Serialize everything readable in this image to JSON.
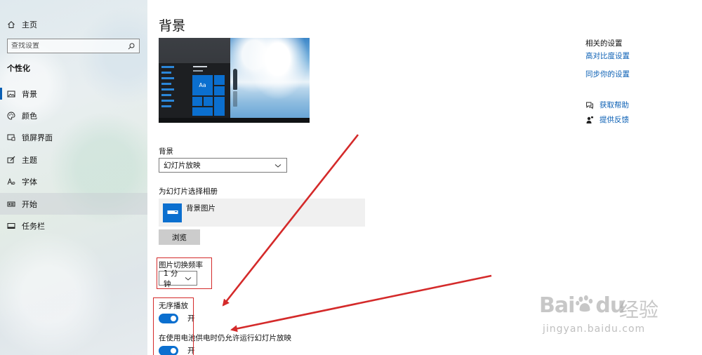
{
  "sidebar": {
    "home_label": "主页",
    "search_placeholder": "查找设置",
    "section_title": "个性化",
    "items": [
      {
        "label": "背景",
        "icon": "image-icon"
      },
      {
        "label": "颜色",
        "icon": "palette-icon"
      },
      {
        "label": "锁屏界面",
        "icon": "lock-screen-icon"
      },
      {
        "label": "主题",
        "icon": "theme-icon"
      },
      {
        "label": "字体",
        "icon": "font-icon"
      },
      {
        "label": "开始",
        "icon": "start-icon"
      },
      {
        "label": "任务栏",
        "icon": "taskbar-icon"
      }
    ]
  },
  "main": {
    "title": "背景",
    "preview_tile_text": "Aa",
    "background_label": "背景",
    "background_value": "幻灯片放映",
    "album_label": "为幻灯片选择相册",
    "album_name": "背景图片",
    "browse_label": "浏览",
    "frequency_label": "图片切换频率",
    "frequency_value": "1 分钟",
    "shuffle_label": "无序播放",
    "shuffle_state": "开",
    "battery_label": "在使用电池供电时仍允许运行幻灯片放映",
    "battery_state": "开"
  },
  "related": {
    "title": "相关的设置",
    "links": [
      "高对比度设置",
      "同步你的设置"
    ],
    "help_label": "获取帮助",
    "feedback_label": "提供反馈"
  },
  "watermark": {
    "logo": "Bai",
    "logo_tail": "du",
    "cn": "经验",
    "url": "jingyan.baidu.com"
  },
  "colors": {
    "accent": "#0b6fcf",
    "link": "#0a5fb4",
    "annotation": "#d42a2a"
  }
}
